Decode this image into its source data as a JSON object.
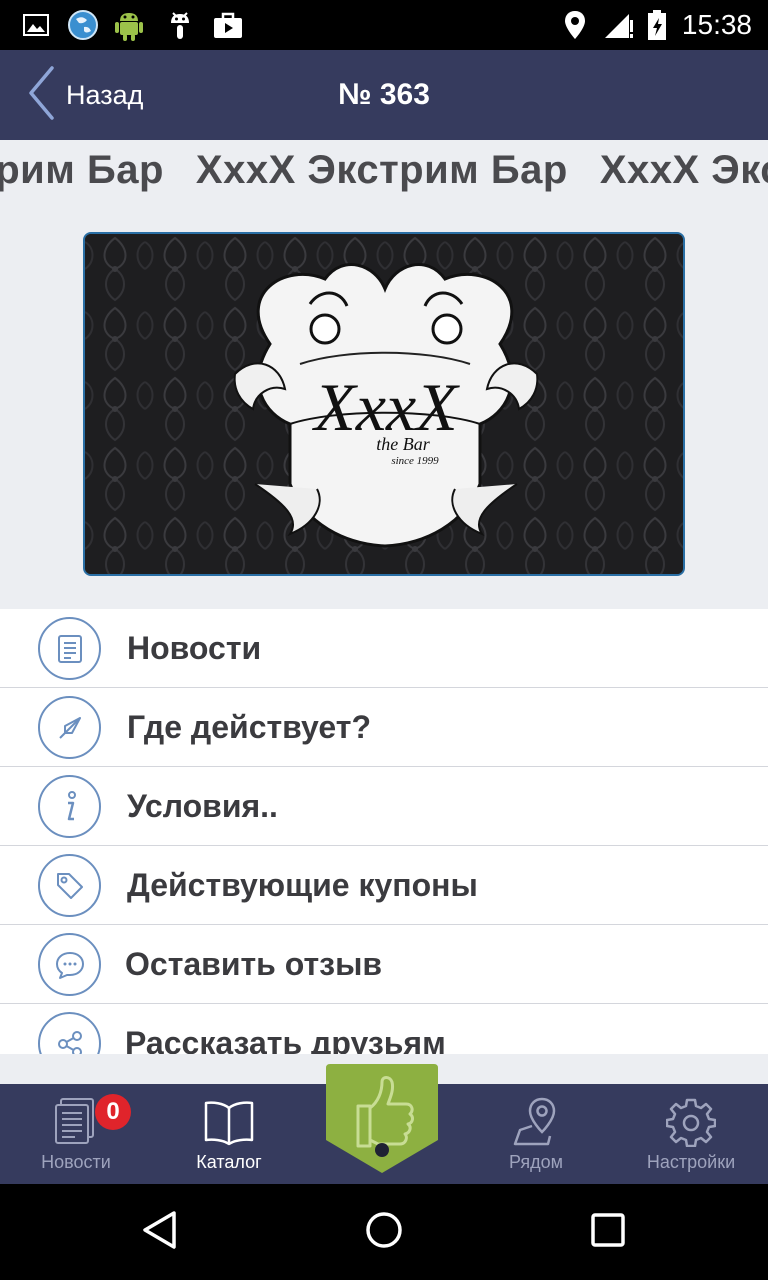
{
  "status_bar": {
    "time": "15:38",
    "icons": [
      "image-icon",
      "globe-icon",
      "android-icon",
      "android-debug-icon",
      "shopping-bag-icon",
      "location-icon",
      "signal-icon",
      "battery-icon"
    ]
  },
  "header": {
    "back_label": "Назад",
    "title": "№ 363"
  },
  "marquee": {
    "text": "XxxX Экстрим Бар"
  },
  "logo": {
    "brand": "XxxX",
    "subtitle": "the Bar",
    "since": "since 1999"
  },
  "menu": {
    "items": [
      {
        "label": "Новости",
        "icon": "news-icon"
      },
      {
        "label": "Где действует?",
        "icon": "compass-icon"
      },
      {
        "label": "Условия..",
        "icon": "info-icon"
      },
      {
        "label": "Действующие купоны",
        "icon": "tag-icon"
      },
      {
        "label": "Оставить отзыв",
        "icon": "chat-icon"
      },
      {
        "label": "Рассказать друзьям",
        "icon": "share-icon"
      }
    ]
  },
  "tabbar": {
    "news_label": "Новости",
    "news_badge": "0",
    "catalog_label": "Каталог",
    "nearby_label": "Рядом",
    "settings_label": "Настройки",
    "active_tab": "catalog"
  },
  "colors": {
    "bar_bg": "#363b5e",
    "accent_green": "#8db041",
    "icon_blue": "#6b8fbf",
    "badge_red": "#e0242b"
  }
}
